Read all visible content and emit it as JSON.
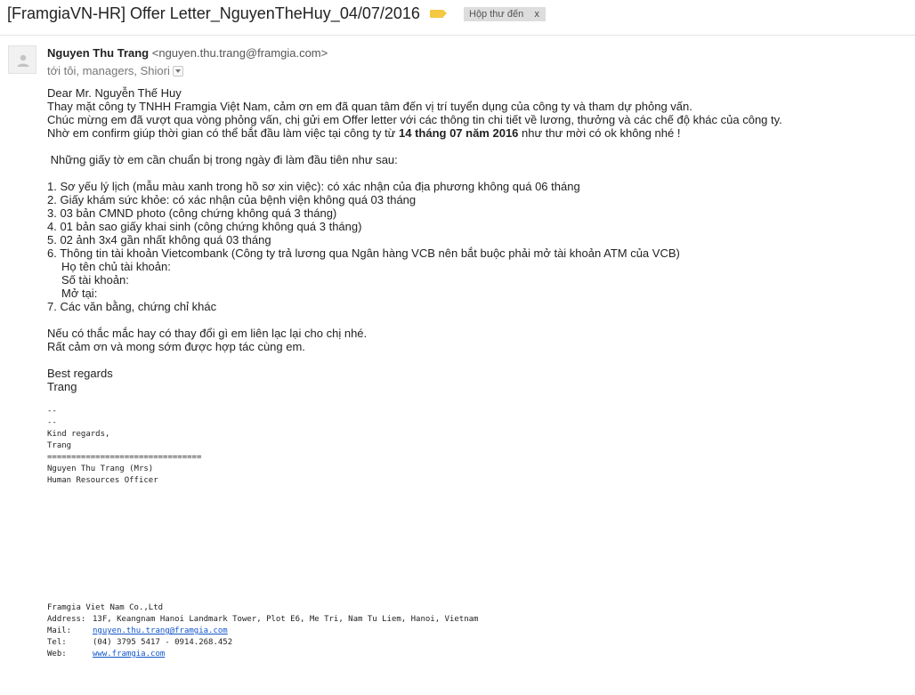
{
  "header": {
    "subject": "[FramgiaVN-HR] Offer Letter_NguyenTheHuy_04/07/2016",
    "label_icon": "important-marker",
    "inbox_chip": "Hộp thư đến",
    "inbox_chip_close": "x"
  },
  "sender": {
    "name": "Nguyen Thu Trang",
    "email": "<nguyen.thu.trang@framgia.com>",
    "recipients": "tới tôi, managers, Shiori"
  },
  "body": {
    "greeting": "Dear Mr. Nguyễn Thế Huy",
    "p1": "Thay mặt công ty TNHH Framgia Việt Nam, cảm ơn em đã quan tâm đến vị trí tuyển dụng của công ty và tham dự phỏng vấn.",
    "p2": "Chúc mừng em đã vượt qua vòng phỏng vấn, chị gửi em Offer letter với các thông tin chi tiết về lương, thưởng và các chế độ khác của công ty.",
    "p3_before": "Nhờ em confirm giúp thời gian có thể bắt đầu làm việc tại công ty từ ",
    "p3_date": "14 tháng 07 năm 2016",
    "p3_after": " như thư mời có ok không nhé !",
    "docs_intro": " Những giấy tờ em cần chuẩn bị trong ngày đi làm đầu tiên như sau:",
    "docs": [
      "1. Sơ yếu lý lịch (mẫu màu xanh trong hồ sơ xin việc): có xác nhận của địa phương không quá 06 tháng",
      "2. Giấy khám sức khỏe: có xác nhận của bệnh viện không quá 03 tháng",
      "3. 03 bản CMND photo (công chứng không quá 3 tháng)",
      "4. 01 bản sao giấy khai sinh (công chứng không quá 3 tháng)",
      "5. 02 ảnh 3x4 gần nhất không quá 03 tháng",
      "6. Thông tin tài khoản Vietcombank (Công ty trả lương qua Ngân hàng VCB nên bắt buộc phải mở tài khoản ATM của VCB)"
    ],
    "bank_fields": [
      "Họ tên chủ tài khoản:",
      "Số tài khoản:",
      "Mở tại:"
    ],
    "doc7": "7. Các văn bằng, chứng chỉ khác",
    "closing1": "Nếu có thắc mắc hay có thay đổi gì em liên lạc lại cho chị nhé.",
    "closing2": "Rất cảm ơn và mong sớm được hợp tác cùng em.",
    "regards": "Best regards",
    "signoff": "Trang"
  },
  "signature": {
    "dash1": "--",
    "dash2": "--",
    "kind_regards": "Kind regards,",
    "name_short": "Trang",
    "separator": "================================",
    "full_name": "Nguyen Thu Trang (Mrs)",
    "title": "Human Resources Officer"
  },
  "footer": {
    "company": "Framgia Viet Nam Co.,Ltd",
    "address_label": "Address:",
    "address": "13F, Keangnam Hanoi Landmark Tower, Plot E6, Me Tri, Nam Tu Liem, Hanoi, Vietnam",
    "mail_label": "Mail:",
    "mail": "nguyen.thu.trang@framgia.com",
    "tel_label": "Tel:",
    "tel": "(04) 3795 5417 - 0914.268.452",
    "web_label": "Web:",
    "web": "www.framgia.com"
  }
}
